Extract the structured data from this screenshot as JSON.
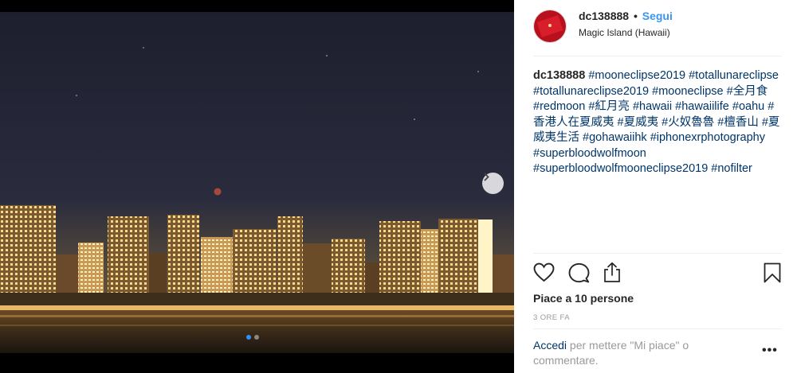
{
  "post": {
    "username": "dc138888",
    "separator": "•",
    "follow_label": "Segui",
    "location": "Magic Island (Hawaii)"
  },
  "caption": {
    "username": "dc138888",
    "tags": [
      "#mooneclipse2019",
      "#totallunareclipse",
      "#totallunareclipse2019",
      "#mooneclipse",
      "#全月食",
      "#redmoon",
      "#紅月亮",
      "#hawaii",
      "#hawaiilife",
      "#oahu",
      "#香港人在夏威夷",
      "#夏威夷",
      "#火奴魯魯",
      "#檀香山",
      "#夏威夷生活",
      "#gohawaiihk",
      "#iphonexrphotography",
      "#superbloodwolfmoon",
      "#superbloodwolfmooneclipse2019",
      "#nofilter"
    ]
  },
  "likes": "Piace a 10 persone",
  "time": "3 ORE FA",
  "login": {
    "link": "Accedi",
    "text": " per mettere \"Mi piace\" o commentare."
  },
  "more_label": "•••",
  "carousel": {
    "slides": 2,
    "current": 1
  }
}
